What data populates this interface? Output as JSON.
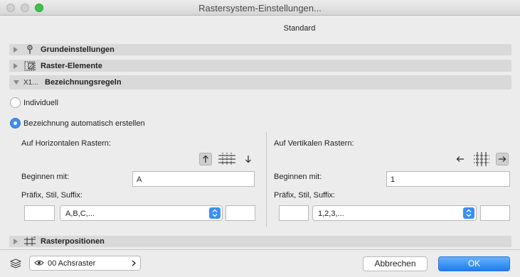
{
  "window": {
    "title": "Rastersystem-Einstellungen..."
  },
  "preset": {
    "name": "Standard"
  },
  "sections": {
    "grundeinstellungen": "Grundeinstellungen",
    "raster_elemente": "Raster-Elemente",
    "bezeichnungsregeln_prefix": "X1...",
    "bezeichnungsregeln": "Bezeichnungsregeln",
    "rasterpositionen": "Rasterpositionen"
  },
  "naming": {
    "individual_label": "Individuell",
    "auto_label": "Bezeichnung automatisch erstellen",
    "selected": "auto"
  },
  "horizontal": {
    "heading": "Auf Horizontalen Rastern:",
    "start_label": "Beginnen mit:",
    "start_value": "A",
    "affix_label": "Präfix, Stil, Suffix:",
    "prefix_value": "",
    "style_value": "A,B,C,...",
    "suffix_value": ""
  },
  "vertical": {
    "heading": "Auf Vertikalen Rastern:",
    "start_label": "Beginnen mit:",
    "start_value": "1",
    "affix_label": "Präfix, Stil, Suffix:",
    "prefix_value": "",
    "style_value": "1,2,3,...",
    "suffix_value": ""
  },
  "footer": {
    "layer_value": "00 Achsraster",
    "cancel_label": "Abbrechen",
    "ok_label": "OK"
  },
  "colors": {
    "accent": "#3b8ff0",
    "section_bar": "#d9d9d9"
  }
}
